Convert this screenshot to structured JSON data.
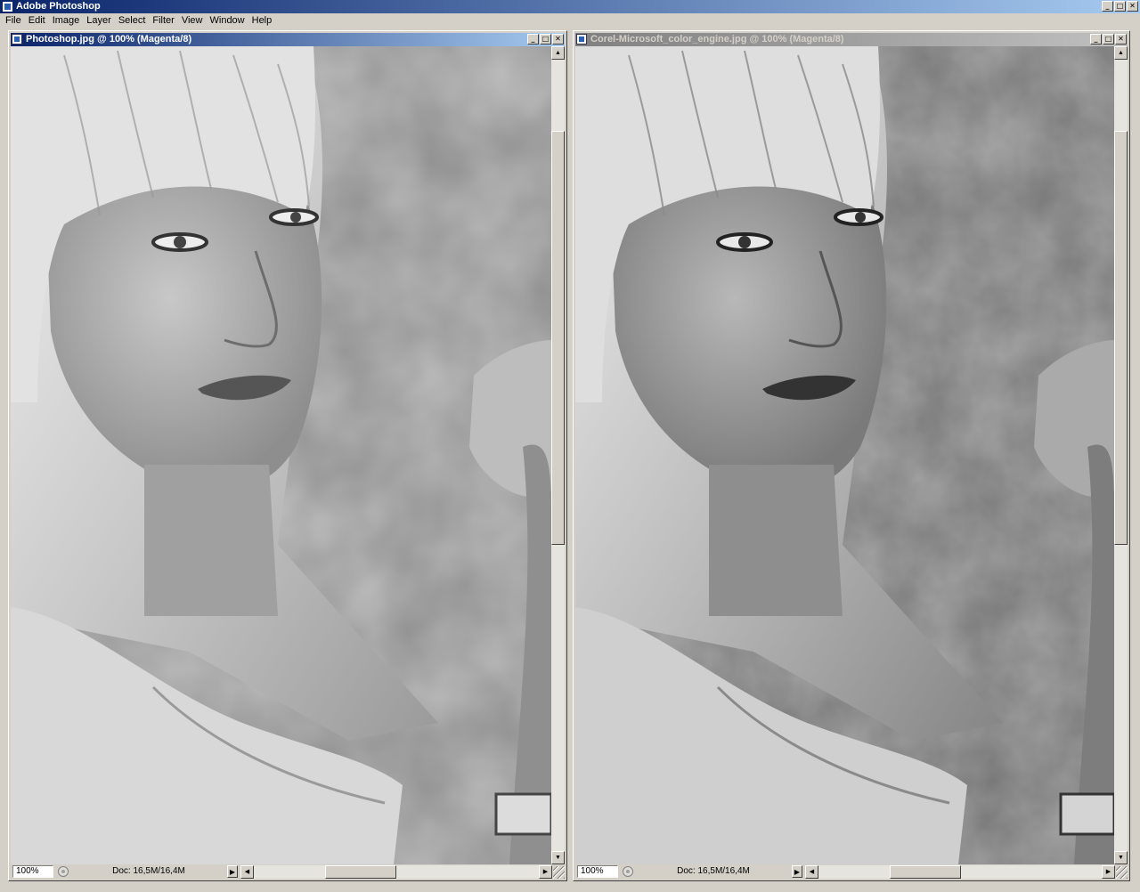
{
  "app": {
    "title": "Adobe Photoshop",
    "window_controls": {
      "minimize": "_",
      "maximize": "□",
      "close": "✕"
    }
  },
  "menu": [
    "File",
    "Edit",
    "Image",
    "Layer",
    "Select",
    "Filter",
    "View",
    "Window",
    "Help"
  ],
  "documents": [
    {
      "title": "Photoshop.jpg @ 100% (Magenta/8)",
      "active": true,
      "zoom": "100%",
      "doc_info": "Doc: 16,5M/16,4M",
      "icons": {
        "title": "photoshop-document-icon",
        "status": "status-indicator-icon"
      }
    },
    {
      "title": "Corel-Microsoft_color_engine.jpg @ 100% (Magenta/8)",
      "active": false,
      "zoom": "100%",
      "doc_info": "Doc: 16,5M/16,4M",
      "icons": {
        "title": "photoshop-document-icon",
        "status": "status-indicator-icon"
      }
    }
  ],
  "scroll_glyphs": {
    "up": "▲",
    "down": "▼",
    "left": "◀",
    "right": "▶"
  },
  "status_arrow_glyph": "▶",
  "colors": {
    "active_title_start": "#0a246a",
    "active_title_end": "#a6caf0",
    "inactive_title_start": "#808080",
    "inactive_title_end": "#c0c0c0",
    "chrome": "#d4d0c8"
  }
}
